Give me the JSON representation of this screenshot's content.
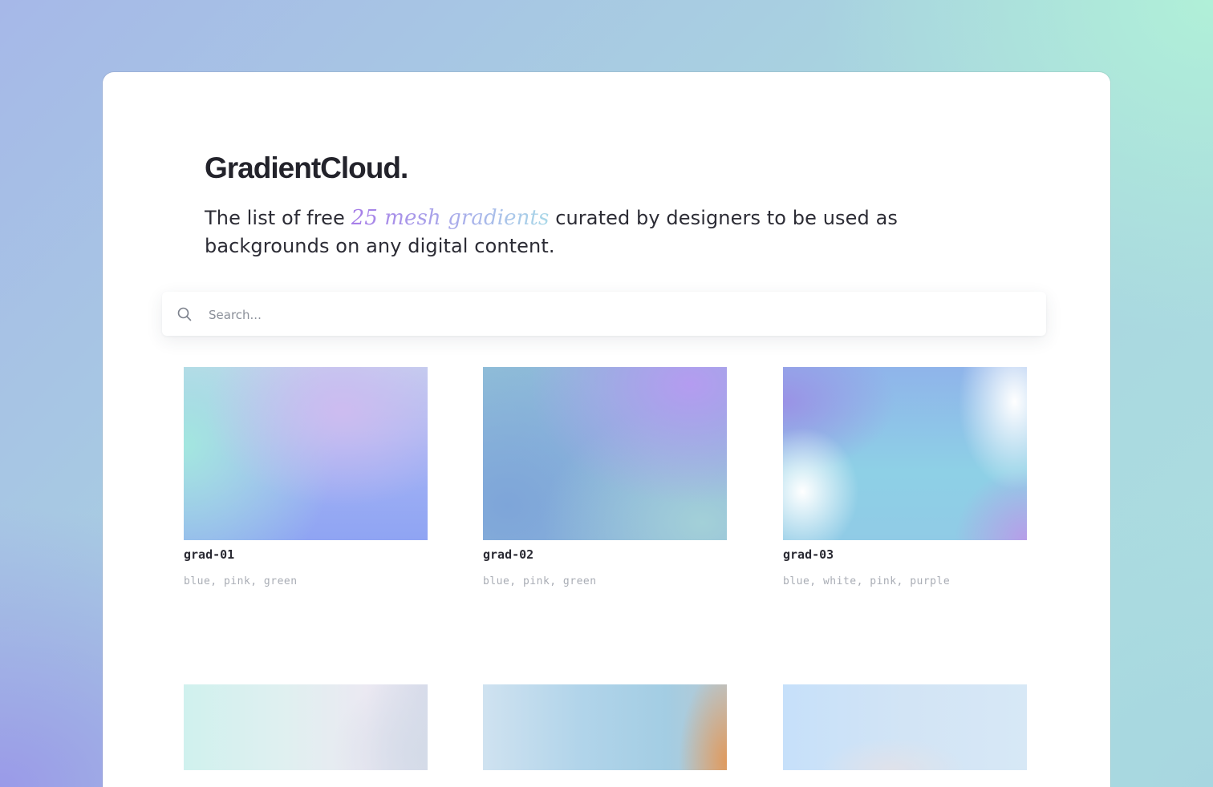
{
  "header": {
    "title": "GradientCloud.",
    "intro_before": "The list of free",
    "intro_highlight": "25 mesh gradients",
    "intro_after": "curated by designers to be used as backgrounds on any digital content."
  },
  "search": {
    "placeholder": "Search...",
    "icon": "search-icon"
  },
  "gradients": [
    {
      "name": "grad-01",
      "tags": "blue, pink, green"
    },
    {
      "name": "grad-02",
      "tags": "blue, pink, green"
    },
    {
      "name": "grad-03",
      "tags": "blue, white, pink, purple"
    }
  ],
  "colors": {
    "title": "#23232b",
    "highlight_start": "#a77de8",
    "highlight_end": "#a9d8e8",
    "tags": "#a9adb5"
  }
}
